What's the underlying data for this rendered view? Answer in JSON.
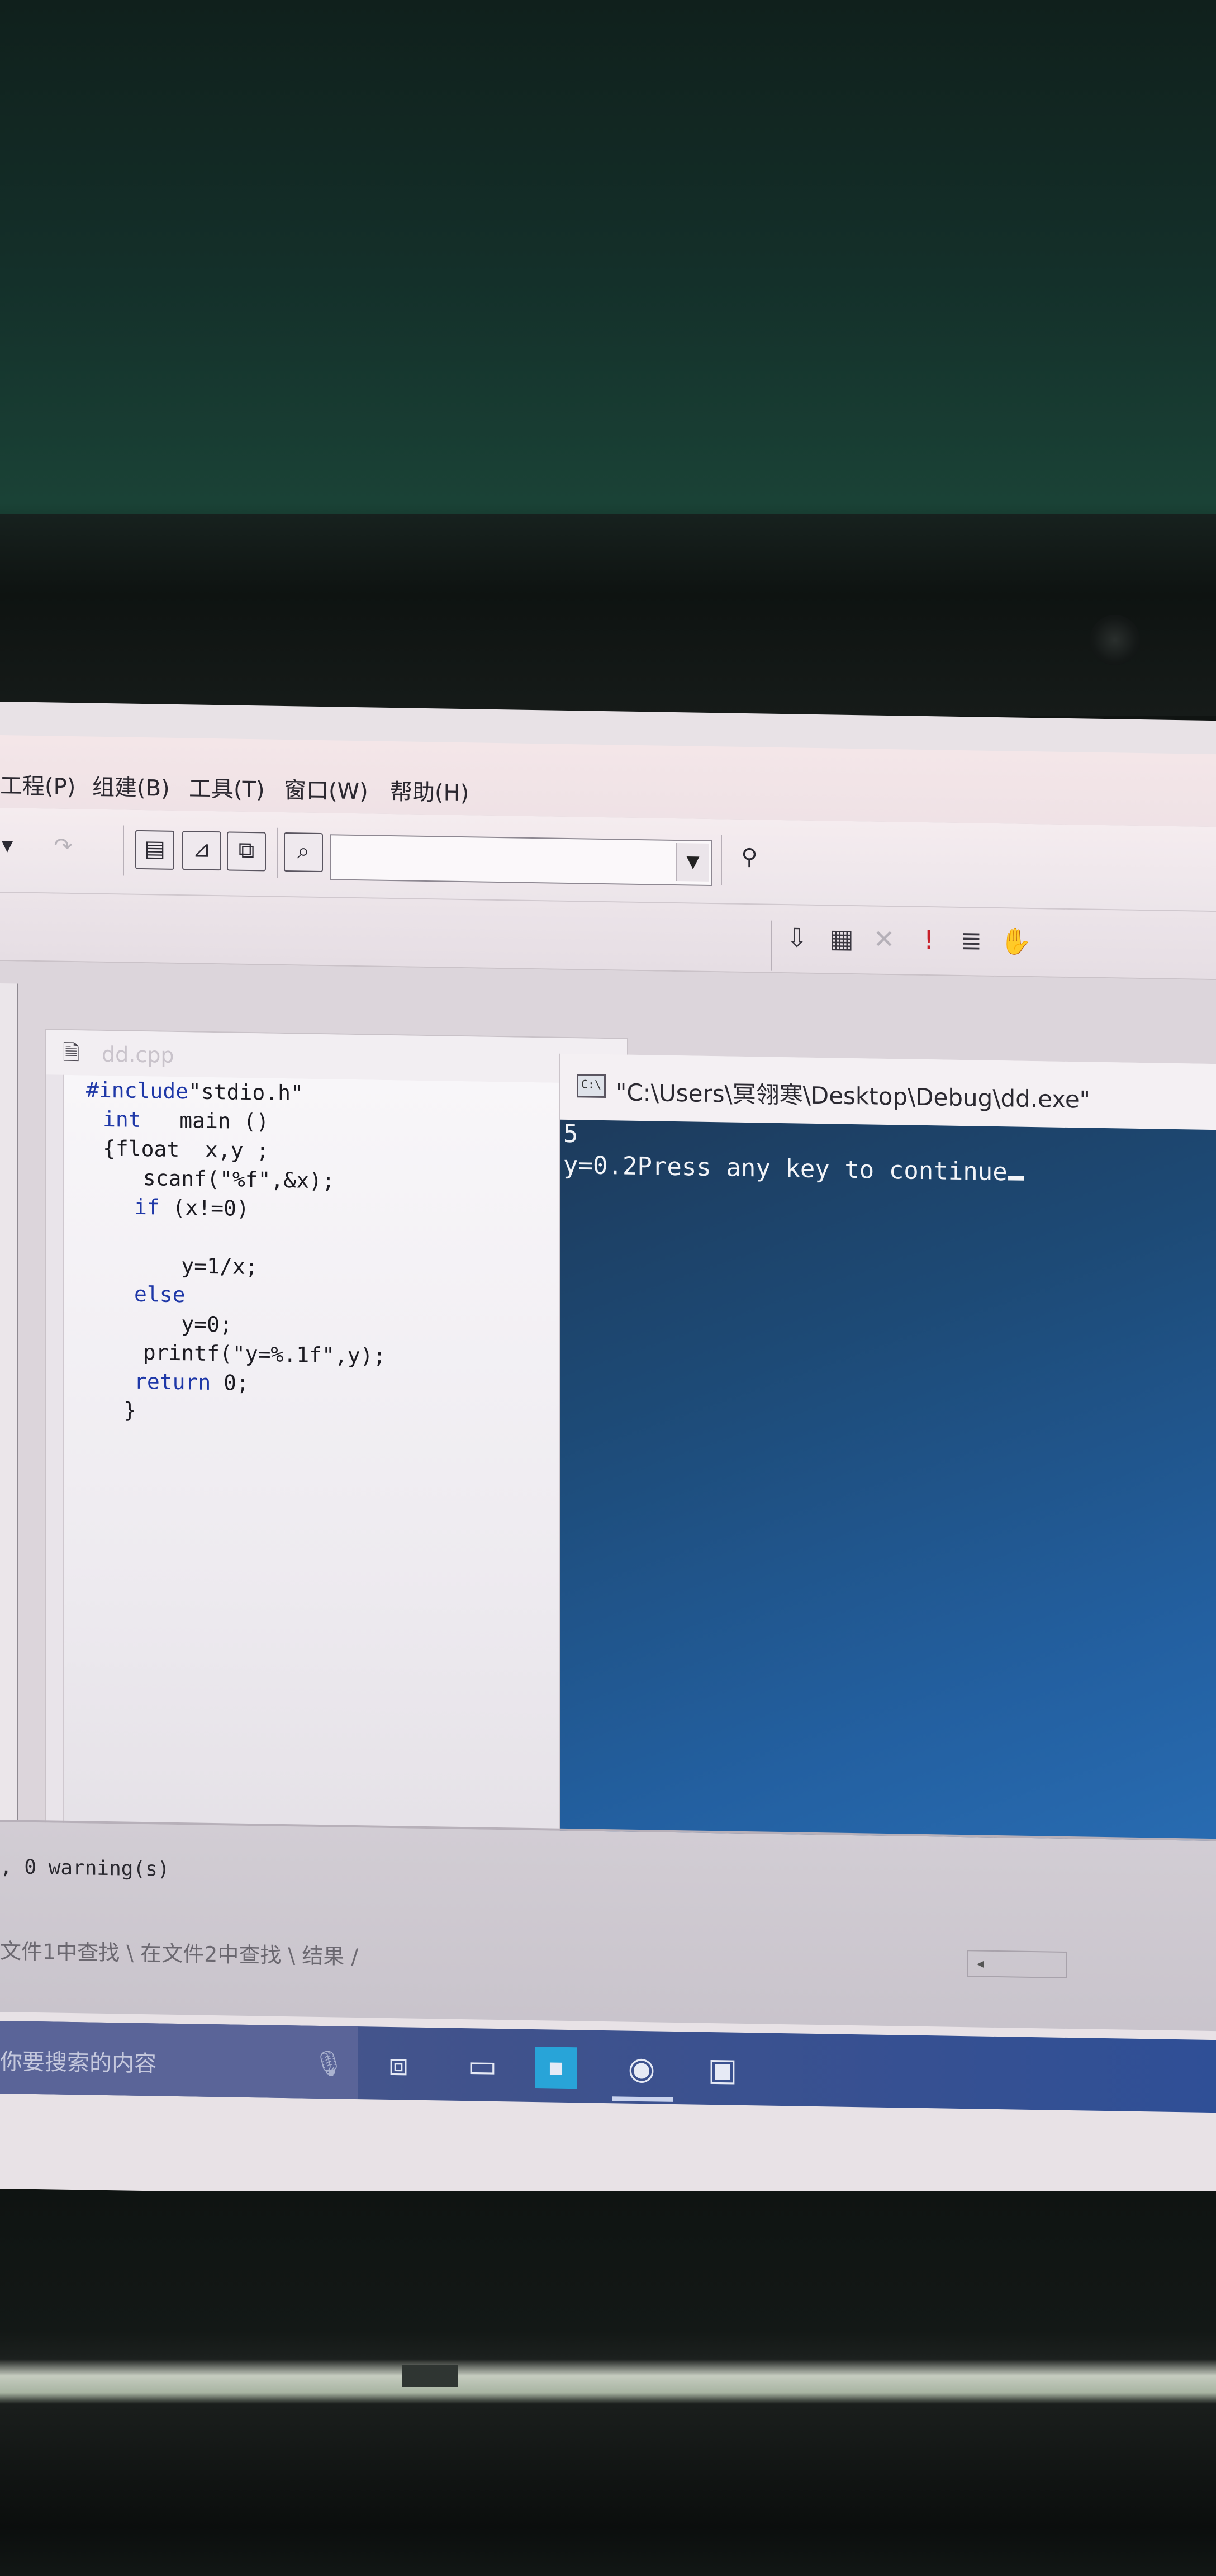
{
  "menubar": {
    "items": [
      {
        "label": "工程(P)"
      },
      {
        "label": "组建(B)"
      },
      {
        "label": "工具(T)"
      },
      {
        "label": "窗口(W)"
      },
      {
        "label": "帮助(H)"
      }
    ]
  },
  "toolbar": {
    "combo_value": ""
  },
  "editor": {
    "filename": "dd.cpp",
    "code_lines": [
      {
        "kw": "#include",
        "text": "\"stdio.h\""
      },
      {
        "kw": "int",
        "text": "   main ()"
      },
      {
        "kw": "",
        "text": "{float  x,y ;"
      },
      {
        "kw": "",
        "text": "  scanf(\"%f\",&x);"
      },
      {
        "kw": "if",
        "text": " (x!=0)"
      },
      {
        "kw": "",
        "text": ""
      },
      {
        "kw": "",
        "text": "     y=1/x;"
      },
      {
        "kw": "else",
        "text": ""
      },
      {
        "kw": "",
        "text": "     y=0;"
      },
      {
        "kw": "",
        "text": "  printf(\"y=%.1f\",y);"
      },
      {
        "kw": "return",
        "text": " 0;"
      },
      {
        "kw": "",
        "text": " }"
      }
    ]
  },
  "console": {
    "title": "\"C:\\Users\\冥翎寒\\Desktop\\Debug\\dd.exe\"",
    "lines": [
      "5",
      "y=0.2Press any key to continue"
    ]
  },
  "output": {
    "line": ", 0 warning(s)",
    "tabs": "文件1中查找 \\ 在文件2中查找 \\ 结果 /"
  },
  "taskbar": {
    "search_placeholder": "你要搜索的内容"
  }
}
